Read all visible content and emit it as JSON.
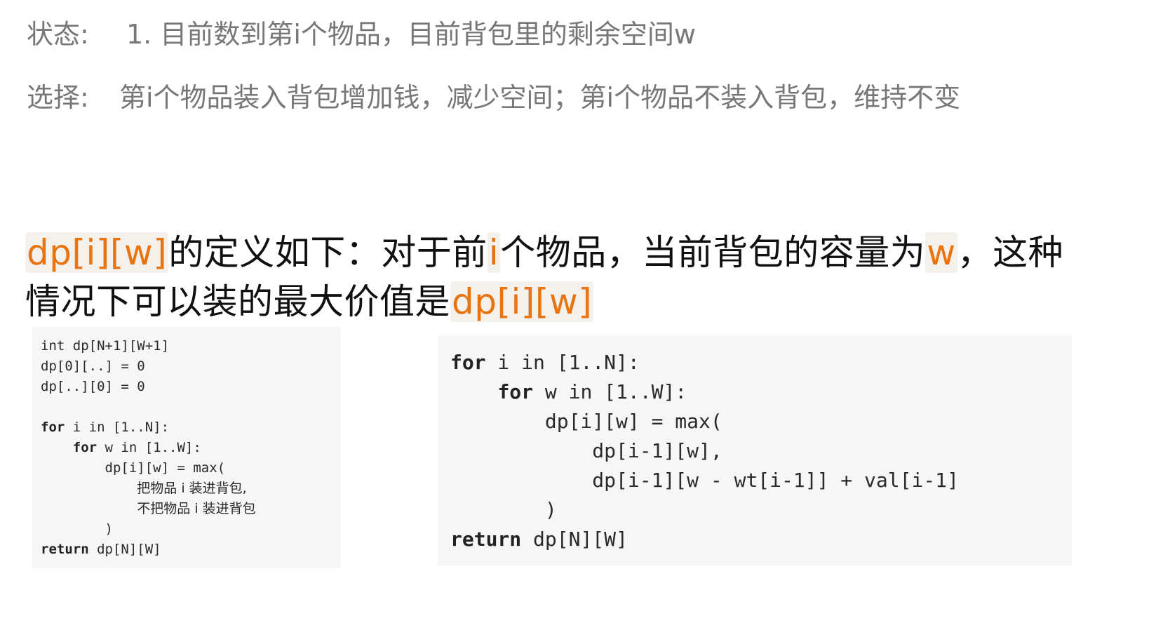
{
  "state_line": {
    "label": "状态:",
    "text": "1. 目前数到第i个物品，目前背包里的剩余空间w"
  },
  "choice_line": {
    "label": "选择:",
    "text": "第i个物品装入背包增加钱，减少空间；第i个物品不装入背包，维持不变"
  },
  "definition": {
    "dp_term": "dp[i][w]",
    "part1": "的定义如下：对于前",
    "i_term": "i",
    "part2": "个物品，当前背包的容量为",
    "w_term": "w",
    "part3": "，这种",
    "part4": "情况下可以装的最大价值是",
    "dp_term2": "dp[i][w]"
  },
  "left_code": {
    "l1": "int dp[N+1][W+1]",
    "l2": "dp[0][..] = 0",
    "l3": "dp[..][0] = 0",
    "l4": "",
    "l5_kw": "for",
    "l5_rest": " i in [1..N]:",
    "l6_kw": "for",
    "l6_rest": " w in [1..W]:",
    "l7": "dp[i][w] = max(",
    "l8": "把物品 i 装进背包,",
    "l9": "不把物品 i 装进背包",
    "l10": ")",
    "l11_kw": "return",
    "l11_rest": " dp[N][W]"
  },
  "right_code": {
    "l1_kw": "for",
    "l1_rest": " i in [1..N]:",
    "l2_kw": "for",
    "l2_rest": " w in [1..W]:",
    "l3": "dp[i][w] = max(",
    "l4": "dp[i-1][w],",
    "l5": "dp[i-1][w - wt[i-1]] + val[i-1]",
    "l6": ")",
    "l7_kw": "return",
    "l7_rest": " dp[N][W]"
  }
}
